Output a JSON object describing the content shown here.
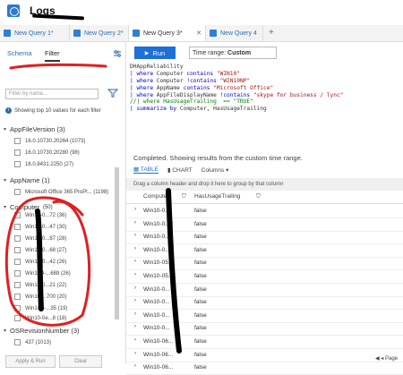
{
  "app": {
    "title": "Logs"
  },
  "tabs": [
    {
      "label": "New Query 1*",
      "active": false
    },
    {
      "label": "New Query 2*",
      "active": false
    },
    {
      "label": "New Query 3*",
      "active": true
    },
    {
      "label": "New Query 4",
      "active": false
    }
  ],
  "left_pane": {
    "tabs": [
      "Schema",
      "Filter"
    ],
    "search_placeholder": "Filter by name...",
    "info": "Showing top 10 values for each filter",
    "groups": [
      {
        "name": "AppFileVersion (3)",
        "items": [
          "16.0.10730.20264 (1073)",
          "16.0.10730.20280 (98)",
          "16.0.8431.2250 (27)"
        ]
      },
      {
        "name": "AppName (1)",
        "items": [
          "Microsoft Office 365 ProPl... (1198)"
        ]
      },
      {
        "name": "Computer",
        "count": "(50)",
        "items": [
          "Win10-0...72 (36)",
          "Win10-0...47 (30)",
          "Win10-0...87 (28)",
          "Win10-0...68 (27)",
          "Win10-0...42 (26)",
          "Win10D-...688 (26)",
          "Win10-0...21 (22)",
          "Win10-...700 (20)",
          "Win10D-...35 (19)",
          "Win10-0e...8 (18)"
        ]
      },
      {
        "name": "OSRevisionNumber (3)",
        "items": [
          "437 (1013)"
        ]
      }
    ],
    "apply_button": "Apply & Run",
    "clear_button": "Clear"
  },
  "toolbar": {
    "run_label": "Run",
    "time_range_label": "Time range:",
    "time_range_value": "Custom"
  },
  "query_lines": [
    [
      [
        "",
        "DHAppReliability"
      ]
    ],
    [
      [
        "kw",
        "| where"
      ],
      [
        "",
        " Computer "
      ],
      [
        "kw",
        "contains"
      ],
      [
        "str",
        " \"WIN10\""
      ]
    ],
    [
      [
        "kw",
        "| where"
      ],
      [
        "",
        " Computer "
      ],
      [
        "kw",
        "!contains"
      ],
      [
        "str",
        " \"WIN10NP\""
      ]
    ],
    [
      [
        "kw",
        "| where"
      ],
      [
        "",
        " AppName "
      ],
      [
        "kw",
        "contains"
      ],
      [
        "str",
        " \"Microsoft Office\""
      ]
    ],
    [
      [
        "kw",
        "| where"
      ],
      [
        "",
        " AppFileDisplayName "
      ],
      [
        "kw",
        "!contains"
      ],
      [
        "str",
        " \"skype for business / lync\""
      ]
    ],
    [
      [
        "cmt",
        "//| where HasUsageTrailing  == \"TRUE\""
      ]
    ],
    [
      [
        "kw",
        "| summarize by"
      ],
      [
        "",
        " Computer, HasUsageTrailing"
      ]
    ]
  ],
  "results": {
    "status": "Completed. Showing results from the custom time range.",
    "tabs": [
      "TABLE",
      "CHART",
      "Columns"
    ],
    "group_hint": "Drag a column header and drop it here to group by that column",
    "columns": [
      "Computer",
      "HasUsageTrailing"
    ],
    "rows": [
      [
        "Win10-0...",
        "false"
      ],
      [
        "Win10-0...2",
        "false"
      ],
      [
        "Win10-0...",
        "false"
      ],
      [
        "Win10-0...",
        "false"
      ],
      [
        "Win10-05...",
        "false"
      ],
      [
        "Win10-05...",
        "false"
      ],
      [
        "Win10-0...",
        "false"
      ],
      [
        "Win10-0...",
        "false"
      ],
      [
        "Win10-0...",
        "false"
      ],
      [
        "Win10-0...",
        "false"
      ],
      [
        "Win10-06...",
        "false"
      ],
      [
        "Win10-06...",
        "false"
      ],
      [
        "Win10-06...",
        "false"
      ]
    ],
    "pager_label": "Page"
  },
  "colors": {
    "accent": "#1e6fd9",
    "link": "#2b6cb0",
    "annotation": "#e02020"
  }
}
